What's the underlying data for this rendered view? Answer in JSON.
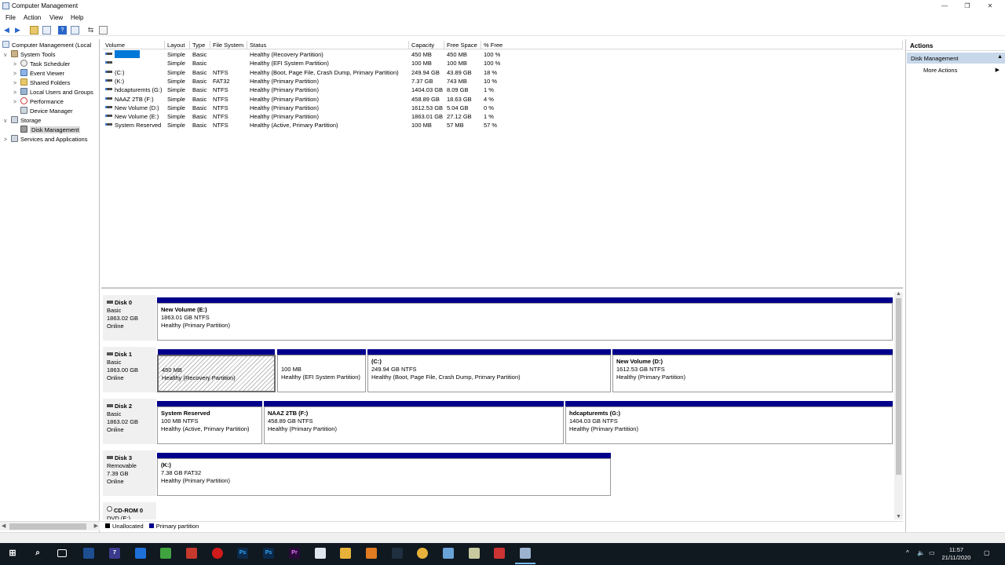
{
  "window": {
    "title": "Computer Management",
    "buttons": [
      "—",
      "❐",
      "✕"
    ]
  },
  "menu": [
    "File",
    "Action",
    "View",
    "Help"
  ],
  "tree": [
    {
      "label": "Computer Management (Local",
      "level": 0,
      "exp": ""
    },
    {
      "label": "System Tools",
      "level": 1,
      "exp": "v"
    },
    {
      "label": "Task Scheduler",
      "level": 2,
      "exp": ">"
    },
    {
      "label": "Event Viewer",
      "level": 2,
      "exp": ">"
    },
    {
      "label": "Shared Folders",
      "level": 2,
      "exp": ">"
    },
    {
      "label": "Local Users and Groups",
      "level": 2,
      "exp": ">"
    },
    {
      "label": "Performance",
      "level": 2,
      "exp": ">"
    },
    {
      "label": "Device Manager",
      "level": 2,
      "exp": ""
    },
    {
      "label": "Storage",
      "level": 1,
      "exp": "v"
    },
    {
      "label": "Disk Management",
      "level": 2,
      "exp": ""
    },
    {
      "label": "Services and Applications",
      "level": 1,
      "exp": ">"
    }
  ],
  "volumes": {
    "headers": [
      "Volume",
      "Layout",
      "Type",
      "File System",
      "Status",
      "Capacity",
      "Free Space",
      "% Free"
    ],
    "rows": [
      [
        "",
        "Simple",
        "Basic",
        "",
        "Healthy (Recovery Partition)",
        "450 MB",
        "450 MB",
        "100 %"
      ],
      [
        "",
        "Simple",
        "Basic",
        "",
        "Healthy (EFI System Partition)",
        "100 MB",
        "100 MB",
        "100 %"
      ],
      [
        "(C:)",
        "Simple",
        "Basic",
        "NTFS",
        "Healthy (Boot, Page File, Crash Dump, Primary Partition)",
        "249.94 GB",
        "43.89 GB",
        "18 %"
      ],
      [
        "(K:)",
        "Simple",
        "Basic",
        "FAT32",
        "Healthy (Primary Partition)",
        "7.37 GB",
        "743 MB",
        "10 %"
      ],
      [
        "hdcapturemts (G:)",
        "Simple",
        "Basic",
        "NTFS",
        "Healthy (Primary Partition)",
        "1404.03 GB",
        "8.09 GB",
        "1 %"
      ],
      [
        "NAAZ  2TB (F:)",
        "Simple",
        "Basic",
        "NTFS",
        "Healthy (Primary Partition)",
        "458.89 GB",
        "18.63 GB",
        "4 %"
      ],
      [
        "New Volume (D:)",
        "Simple",
        "Basic",
        "NTFS",
        "Healthy (Primary Partition)",
        "1612.53 GB",
        "5.04 GB",
        "0 %"
      ],
      [
        "New Volume (E:)",
        "Simple",
        "Basic",
        "NTFS",
        "Healthy (Primary Partition)",
        "1863.01 GB",
        "27.12 GB",
        "1 %"
      ],
      [
        "System Reserved",
        "Simple",
        "Basic",
        "NTFS",
        "Healthy (Active, Primary Partition)",
        "100 MB",
        "57 MB",
        "57 %"
      ]
    ]
  },
  "disks": [
    {
      "name": "Disk 0",
      "type": "Basic",
      "size": "1863.02 GB",
      "state": "Online",
      "partitions": [
        {
          "title": "New Volume  (E:)",
          "line2": "1863.01 GB NTFS",
          "line3": "Healthy (Primary Partition)"
        }
      ]
    },
    {
      "name": "Disk 1",
      "type": "Basic",
      "size": "1863.00 GB",
      "state": "Online",
      "partitions": [
        {
          "title": "",
          "line2": "450 MB",
          "line3": "Healthy (Recovery Partition)"
        },
        {
          "title": "",
          "line2": "100 MB",
          "line3": "Healthy (EFI System Partition)"
        },
        {
          "title": "(C:)",
          "line2": "249.94 GB NTFS",
          "line3": "Healthy (Boot, Page File, Crash Dump, Primary Partition)"
        },
        {
          "title": "New Volume  (D:)",
          "line2": "1612.53 GB NTFS",
          "line3": "Healthy (Primary Partition)"
        }
      ]
    },
    {
      "name": "Disk 2",
      "type": "Basic",
      "size": "1863.02 GB",
      "state": "Online",
      "partitions": [
        {
          "title": "System Reserved",
          "line2": "100 MB NTFS",
          "line3": "Healthy (Active, Primary Partition)"
        },
        {
          "title": "NAAZ  2TB  (F:)",
          "line2": "458.89 GB NTFS",
          "line3": "Healthy (Primary Partition)"
        },
        {
          "title": "hdcapturemts  (G:)",
          "line2": "1404.03 GB NTFS",
          "line3": "Healthy (Primary Partition)"
        }
      ]
    },
    {
      "name": "Disk 3",
      "type": "Removable",
      "size": "7.39 GB",
      "state": "Online",
      "partitions": [
        {
          "title": "(K:)",
          "line2": "7.38 GB FAT32",
          "line3": "Healthy (Primary Partition)"
        }
      ]
    },
    {
      "name": "CD-ROM 0",
      "type": "DVD (E:)",
      "size": "",
      "state": "",
      "partitions": []
    }
  ],
  "legend": [
    {
      "label": "Unallocated",
      "color": "#000000"
    },
    {
      "label": "Primary partition",
      "color": "#00008b"
    }
  ],
  "actions": {
    "header": "Actions",
    "section": "Disk Management",
    "more": "More Actions"
  },
  "taskbar": {
    "time": "11:57",
    "date": "21/11/2020"
  }
}
